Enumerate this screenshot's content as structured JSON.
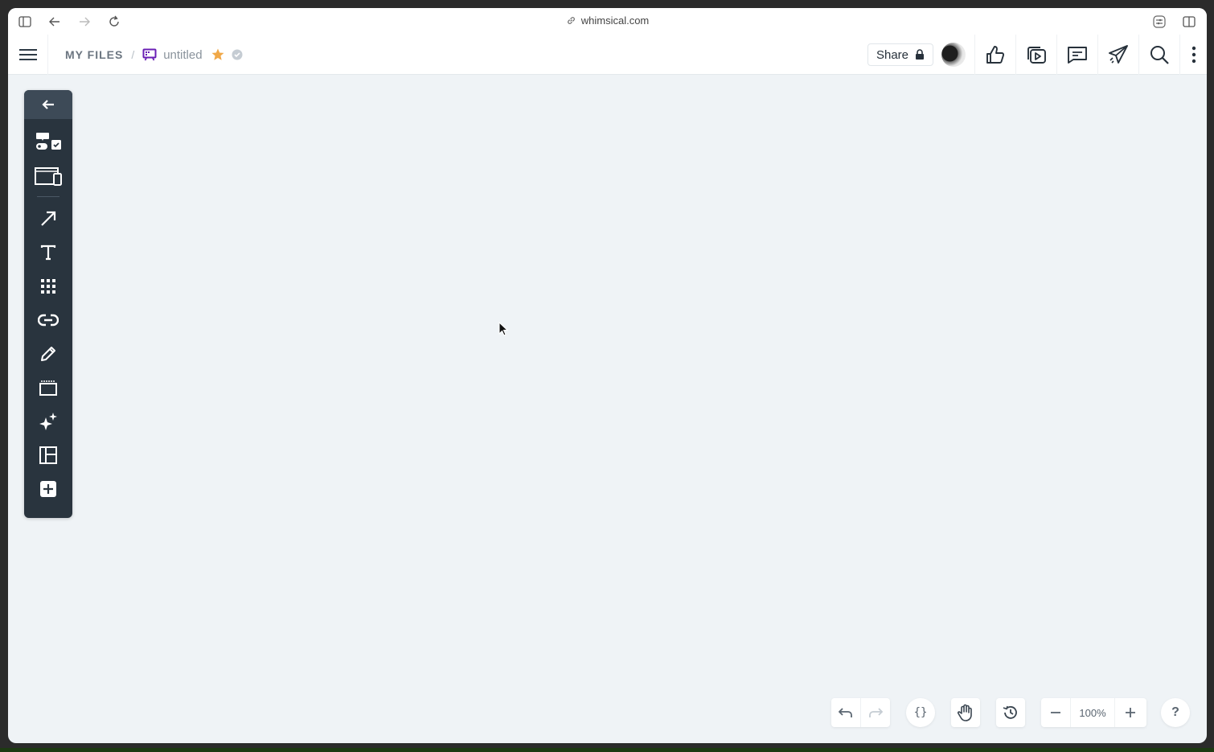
{
  "browser": {
    "url": "whimsical.com"
  },
  "header": {
    "breadcrumb_root": "MY FILES",
    "breadcrumb_separator": "/",
    "file_name": "untitled",
    "share_label": "Share",
    "board_icon_color": "#6a1fb5",
    "star_color": "#f0a848"
  },
  "toolbar": {
    "items": [
      {
        "name": "wireframe-components",
        "icon": "components-icon"
      },
      {
        "name": "device-frame",
        "icon": "device-frame-icon"
      },
      {
        "name": "connector",
        "icon": "arrow-icon"
      },
      {
        "name": "text",
        "icon": "text-icon"
      },
      {
        "name": "grid",
        "icon": "grid-icon"
      },
      {
        "name": "link",
        "icon": "link-icon"
      },
      {
        "name": "pencil",
        "icon": "pencil-icon"
      },
      {
        "name": "section",
        "icon": "section-icon"
      },
      {
        "name": "ai",
        "icon": "sparkle-icon"
      },
      {
        "name": "layout",
        "icon": "layout-icon"
      },
      {
        "name": "more",
        "icon": "plus-icon"
      }
    ]
  },
  "controls": {
    "zoom_level": "100%",
    "help_label": "?",
    "code_label": "{}"
  },
  "colors": {
    "canvas": "#eff3f6",
    "toolbar": "#29343e",
    "toolbar_header": "#3d4a57"
  }
}
